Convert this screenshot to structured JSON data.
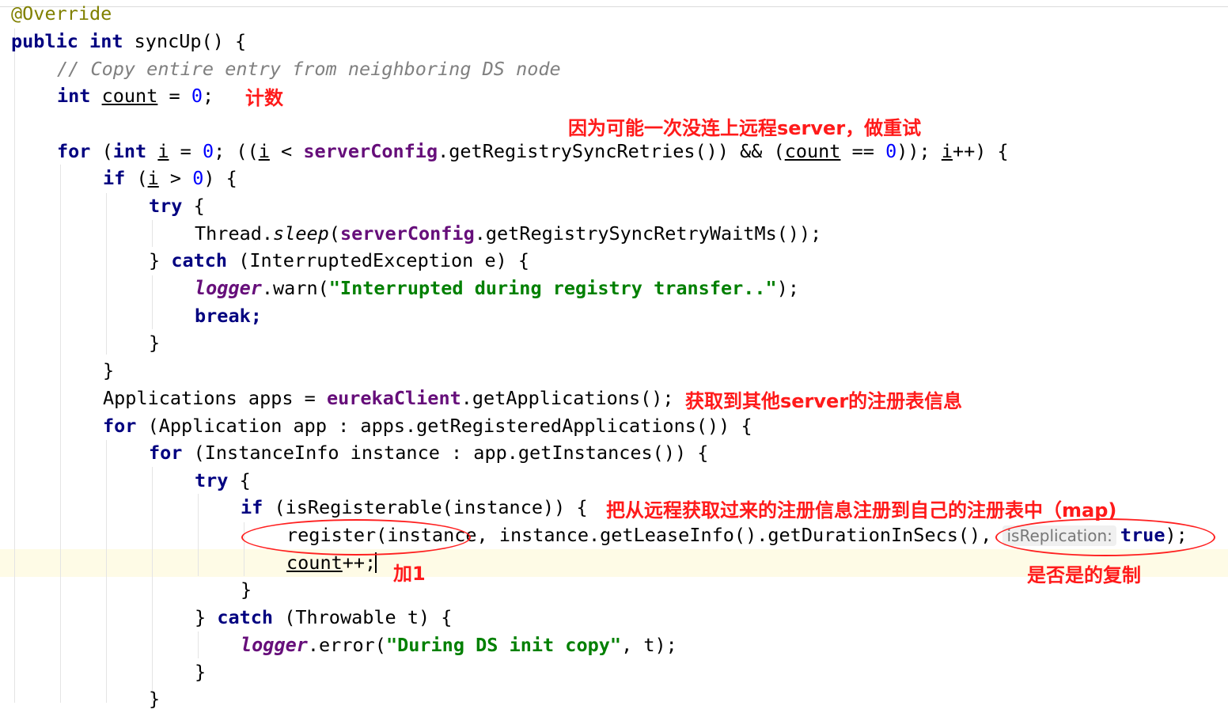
{
  "code": {
    "annotation": "@Override",
    "kw_public": "public",
    "kw_int": "int",
    "m_syncup": "syncUp() {",
    "comment": "// Copy entire entry from neighboring DS node",
    "v_count": "count",
    "eq": " = ",
    "n0": "0",
    "semi": ";",
    "kw_for": "for",
    "kw_if": "if",
    "kw_try": "try",
    "kw_catch": "catch",
    "kw_break": "break;",
    "open_paren": " (",
    "v_i": "i",
    "for_part1": "; ((",
    "lt": " < ",
    "f_serverconfig": "serverConfig",
    "m_getretries": ".getRegistrySyncRetries()) && (",
    "eqeq": " == ",
    "close_for": ")); ",
    "incr": "++) {",
    "gt": " > ",
    "close_if": ") {",
    "brace_open": " {",
    "brace_close": "}",
    "thread": "Thread.",
    "sleep": "sleep",
    "paren": "(",
    "m_getwaitms": ".getRegistrySyncRetryWaitMs());",
    "catch_args": " (InterruptedException e) {",
    "f_logger": "logger",
    "m_warn": ".warn(",
    "s_interrupted": "\"Interrupted during registry transfer..\"",
    "end_call": ");",
    "apps_decl": "Applications apps = ",
    "f_eurekaclient": "eurekaClient",
    "m_getapps": ".getApplications();",
    "for_app": " (Application app : apps.getRegisteredApplications()) {",
    "for_inst": " (InstanceInfo instance : app.getInstances()) {",
    "if_reg": " (isRegisterable(instance)) {",
    "register_call": "register(instance, instance.getLeaseInfo().getDurationInSecs(), ",
    "hint_isreplication": "isReplication:",
    "kw_true": "true",
    "count_incr": "++;",
    "catch_throwable": " (Throwable t) {",
    "m_error": ".error(",
    "s_during": "\"During DS init copy\"",
    "error_tail": ", t);"
  },
  "notes": {
    "count": "计数",
    "retry": "因为可能一次没连上远程server，做重试",
    "get_registry": "获取到其他server的注册表信息",
    "register_local": "把从远程获取过来的注册信息注册到自己的注册表中（map)",
    "add_one": "加1",
    "is_replication": "是否是的复制"
  },
  "colors": {
    "keyword": "#000080",
    "number": "#0000ff",
    "string": "#008000",
    "field": "#660e7a",
    "comment": "#808080",
    "annotation": "#808000",
    "note": "#ff1a1a",
    "current_line": "#fefbe6"
  }
}
